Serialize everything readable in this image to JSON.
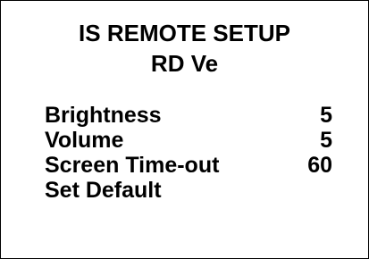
{
  "header": {
    "title_line1": "IS REMOTE SETUP",
    "title_line2": "RD Ve"
  },
  "menu": {
    "items": [
      {
        "label": "Brightness",
        "value": "5"
      },
      {
        "label": "Volume",
        "value": "5"
      },
      {
        "label": "Screen Time-out",
        "value": "60"
      },
      {
        "label": "Set Default",
        "value": ""
      }
    ]
  },
  "colors": {
    "background": "#ffffff",
    "text": "#000000",
    "border": "#000000"
  }
}
